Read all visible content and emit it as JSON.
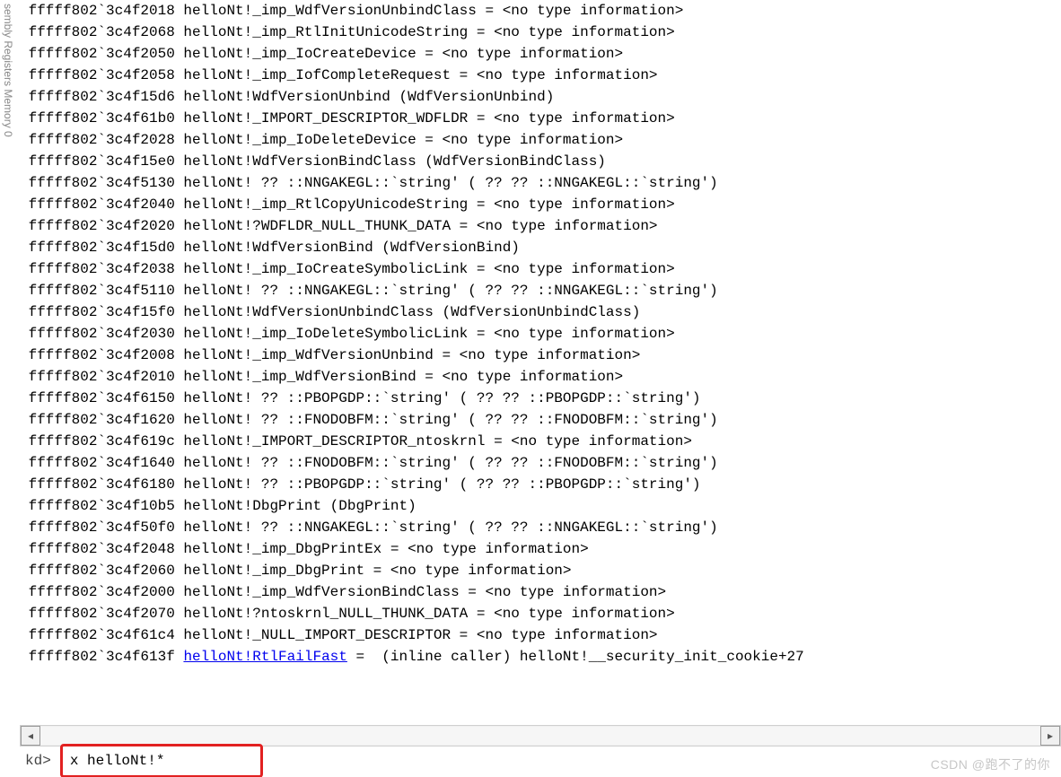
{
  "sidebar": {
    "label": "sembly  Registers  Memory 0"
  },
  "output": {
    "lines": [
      {
        "addr": "fffff802`3c4f2018",
        "text": "helloNt!_imp_WdfVersionUnbindClass = <no type information>"
      },
      {
        "addr": "fffff802`3c4f2068",
        "text": "helloNt!_imp_RtlInitUnicodeString = <no type information>"
      },
      {
        "addr": "fffff802`3c4f2050",
        "text": "helloNt!_imp_IoCreateDevice = <no type information>"
      },
      {
        "addr": "fffff802`3c4f2058",
        "text": "helloNt!_imp_IofCompleteRequest = <no type information>"
      },
      {
        "addr": "fffff802`3c4f15d6",
        "text": "helloNt!WdfVersionUnbind (WdfVersionUnbind)"
      },
      {
        "addr": "fffff802`3c4f61b0",
        "text": "helloNt!_IMPORT_DESCRIPTOR_WDFLDR = <no type information>"
      },
      {
        "addr": "fffff802`3c4f2028",
        "text": "helloNt!_imp_IoDeleteDevice = <no type information>"
      },
      {
        "addr": "fffff802`3c4f15e0",
        "text": "helloNt!WdfVersionBindClass (WdfVersionBindClass)"
      },
      {
        "addr": "fffff802`3c4f5130",
        "text": "helloNt! ?? ::NNGAKEGL::`string' ( ?? ?? ::NNGAKEGL::`string')"
      },
      {
        "addr": "fffff802`3c4f2040",
        "text": "helloNt!_imp_RtlCopyUnicodeString = <no type information>"
      },
      {
        "addr": "fffff802`3c4f2020",
        "text": "helloNt!?WDFLDR_NULL_THUNK_DATA = <no type information>"
      },
      {
        "addr": "fffff802`3c4f15d0",
        "text": "helloNt!WdfVersionBind (WdfVersionBind)"
      },
      {
        "addr": "fffff802`3c4f2038",
        "text": "helloNt!_imp_IoCreateSymbolicLink = <no type information>"
      },
      {
        "addr": "fffff802`3c4f5110",
        "text": "helloNt! ?? ::NNGAKEGL::`string' ( ?? ?? ::NNGAKEGL::`string')"
      },
      {
        "addr": "fffff802`3c4f15f0",
        "text": "helloNt!WdfVersionUnbindClass (WdfVersionUnbindClass)"
      },
      {
        "addr": "fffff802`3c4f2030",
        "text": "helloNt!_imp_IoDeleteSymbolicLink = <no type information>"
      },
      {
        "addr": "fffff802`3c4f2008",
        "text": "helloNt!_imp_WdfVersionUnbind = <no type information>"
      },
      {
        "addr": "fffff802`3c4f2010",
        "text": "helloNt!_imp_WdfVersionBind = <no type information>"
      },
      {
        "addr": "fffff802`3c4f6150",
        "text": "helloNt! ?? ::PBOPGDP::`string' ( ?? ?? ::PBOPGDP::`string')"
      },
      {
        "addr": "fffff802`3c4f1620",
        "text": "helloNt! ?? ::FNODOBFM::`string' ( ?? ?? ::FNODOBFM::`string')"
      },
      {
        "addr": "fffff802`3c4f619c",
        "text": "helloNt!_IMPORT_DESCRIPTOR_ntoskrnl = <no type information>"
      },
      {
        "addr": "fffff802`3c4f1640",
        "text": "helloNt! ?? ::FNODOBFM::`string' ( ?? ?? ::FNODOBFM::`string')"
      },
      {
        "addr": "fffff802`3c4f6180",
        "text": "helloNt! ?? ::PBOPGDP::`string' ( ?? ?? ::PBOPGDP::`string')"
      },
      {
        "addr": "fffff802`3c4f10b5",
        "text": "helloNt!DbgPrint (DbgPrint)"
      },
      {
        "addr": "fffff802`3c4f50f0",
        "text": "helloNt! ?? ::NNGAKEGL::`string' ( ?? ?? ::NNGAKEGL::`string')"
      },
      {
        "addr": "fffff802`3c4f2048",
        "text": "helloNt!_imp_DbgPrintEx = <no type information>"
      },
      {
        "addr": "fffff802`3c4f2060",
        "text": "helloNt!_imp_DbgPrint = <no type information>"
      },
      {
        "addr": "fffff802`3c4f2000",
        "text": "helloNt!_imp_WdfVersionBindClass = <no type information>"
      },
      {
        "addr": "fffff802`3c4f2070",
        "text": "helloNt!?ntoskrnl_NULL_THUNK_DATA = <no type information>"
      },
      {
        "addr": "fffff802`3c4f61c4",
        "text": "helloNt!_NULL_IMPORT_DESCRIPTOR = <no type information>"
      }
    ],
    "link_line": {
      "addr": "fffff802`3c4f613f",
      "link_text": "helloNt!RtlFailFast",
      "rest": " =  (inline caller) helloNt!__security_init_cookie+27"
    }
  },
  "prompt": {
    "label": "kd>",
    "value": "x helloNt!*"
  },
  "scrollbar": {
    "left_glyph": "◂",
    "right_glyph": "▸"
  },
  "watermark": "CSDN @跑不了的你"
}
